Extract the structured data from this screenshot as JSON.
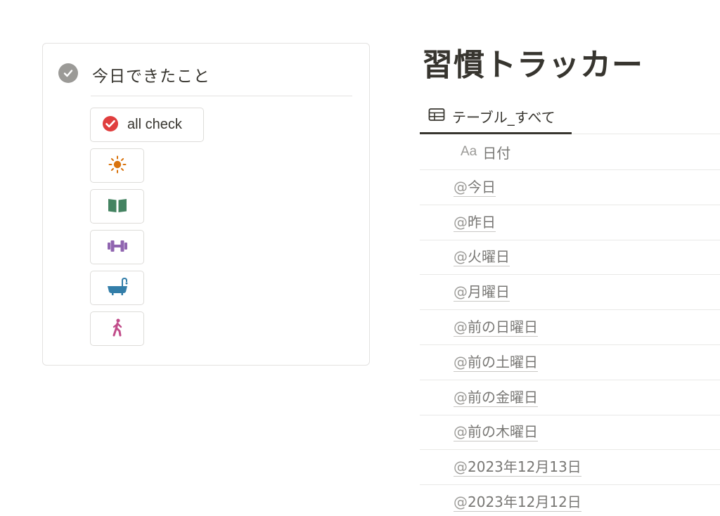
{
  "callout": {
    "title": "今日できたこと",
    "buttons": [
      {
        "label": "all check",
        "icon": "red-check-icon"
      },
      {
        "label": "",
        "icon": "sun-icon"
      },
      {
        "label": "",
        "icon": "book-icon"
      },
      {
        "label": "",
        "icon": "dumbbell-icon"
      },
      {
        "label": "",
        "icon": "bathtub-icon"
      },
      {
        "label": "",
        "icon": "walking-person-icon"
      }
    ]
  },
  "database": {
    "title": "習慣トラッカー",
    "view_tab": "テーブル_すべて",
    "column": {
      "type_label": "Aa",
      "name": "日付"
    },
    "rows": [
      "今日",
      "昨日",
      "火曜日",
      "月曜日",
      "前の日曜日",
      "前の土曜日",
      "前の金曜日",
      "前の木曜日",
      "2023年12月13日",
      "2023年12月12日"
    ],
    "mention_prefix": "@"
  },
  "colors": {
    "text": "#37352f",
    "muted": "#787774",
    "check_red": "#e03e3e",
    "sun": "#d9730d",
    "book": "#448361",
    "dumbbell": "#9065b0",
    "bathtub": "#337ea9",
    "walker": "#c14c8a"
  }
}
